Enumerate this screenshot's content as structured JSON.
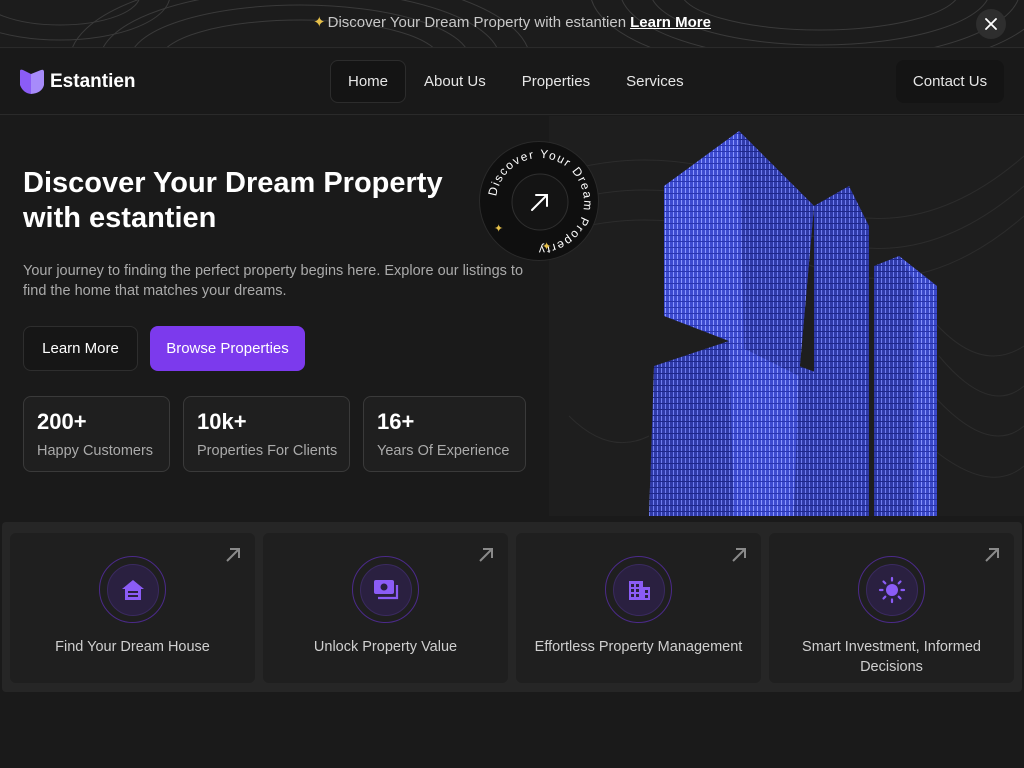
{
  "announcement": {
    "sparkle_icon": "sparkle-icon",
    "text": "Discover Your Dream Property with estantien",
    "link": "Learn More",
    "close_icon": "close-icon"
  },
  "nav": {
    "logo_text": "Estantien",
    "items": [
      {
        "label": "Home",
        "active": true
      },
      {
        "label": "About Us",
        "active": false
      },
      {
        "label": "Properties",
        "active": false
      },
      {
        "label": "Services",
        "active": false
      }
    ],
    "contact_label": "Contact Us"
  },
  "hero": {
    "title": "Discover Your Dream Property with estantien",
    "description": "Your journey to finding the perfect property begins here. Explore our listings to find the home that matches your dreams.",
    "btn_learn": "Learn More",
    "btn_browse": "Browse Properties",
    "badge_text": "Discover Your Dream Property",
    "stats": [
      {
        "value": "200+",
        "label": "Happy Customers"
      },
      {
        "value": "10k+",
        "label": "Properties For Clients"
      },
      {
        "value": "16+",
        "label": "Years Of Experience"
      }
    ]
  },
  "features": [
    {
      "label": "Find Your Dream House",
      "icon": "house-icon"
    },
    {
      "label": "Unlock Property Value",
      "icon": "money-icon"
    },
    {
      "label": "Effortless Property Management",
      "icon": "building-icon"
    },
    {
      "label": "Smart Investment, Informed Decisions",
      "icon": "sun-icon"
    }
  ],
  "colors": {
    "accent": "#7c3aed",
    "background": "#1a1a1a",
    "card": "#1f1f1f"
  }
}
